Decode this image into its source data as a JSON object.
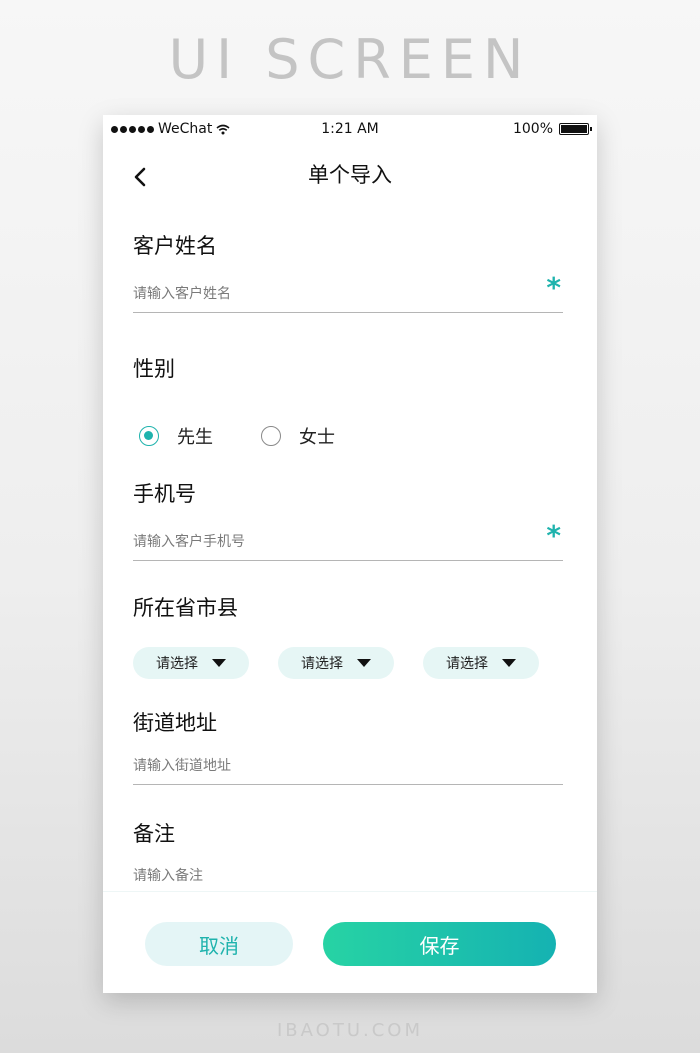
{
  "banner": "UI SCREEN",
  "footer_brand": "IBAOTU.COM",
  "status_bar": {
    "carrier": "WeChat",
    "time": "1:21 AM",
    "battery": "100%",
    "battery_level": 1.0
  },
  "nav": {
    "title": "单个导入",
    "back_icon": "chevron-left-icon"
  },
  "form": {
    "name": {
      "label": "客户姓名",
      "placeholder": "请输入客户姓名",
      "required_mark": "*"
    },
    "gender": {
      "label": "性别",
      "options": [
        {
          "label": "先生",
          "selected": true
        },
        {
          "label": "女士",
          "selected": false
        }
      ]
    },
    "phone": {
      "label": "手机号",
      "placeholder": "请输入客户手机号",
      "required_mark": "*"
    },
    "region": {
      "label": "所在省市县",
      "selects": [
        {
          "value": "请选择"
        },
        {
          "value": "请选择"
        },
        {
          "value": "请选择"
        }
      ]
    },
    "street": {
      "label": "街道地址",
      "placeholder": "请输入街道地址"
    },
    "remark": {
      "label": "备注",
      "placeholder": "请输入备注"
    }
  },
  "actions": {
    "cancel": "取消",
    "save": "保存"
  },
  "colors": {
    "accent": "#1fb3ad",
    "gradient_start": "#27d3a4",
    "gradient_end": "#15b2b2"
  }
}
